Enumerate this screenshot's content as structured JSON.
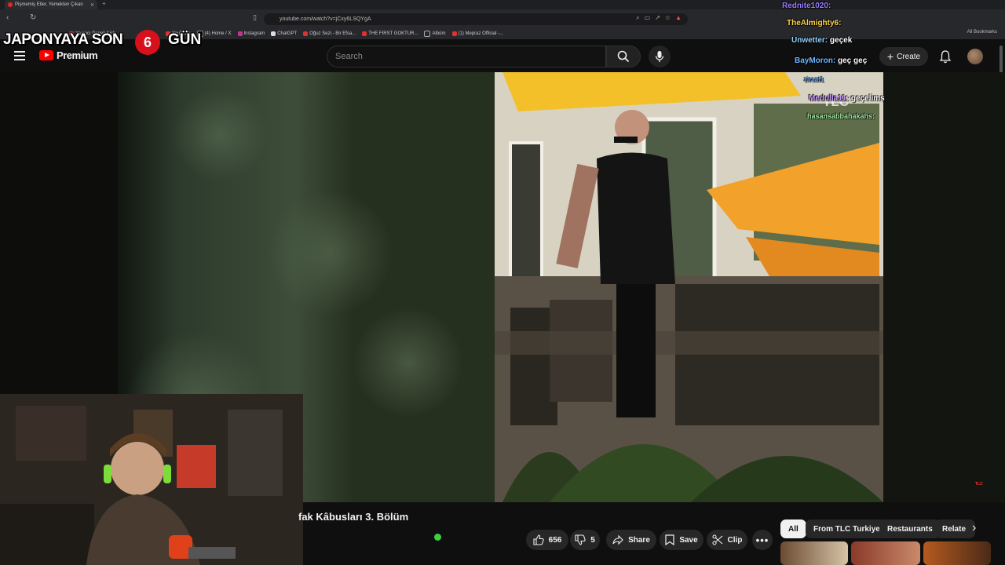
{
  "browser": {
    "tab_title": "Pişmemiş Etler, Yemekten Çıkan",
    "url": "youtube.com/watch?v=jCxy6LSQYgA",
    "bookmarks": [
      "Yayıncı Paneli Kick",
      "YouTube",
      "(4) Home / X",
      "Instagram",
      "ChatGPT",
      "Oğuz Sezi - Bir Efsa...",
      "THE FIRST GOKTUR...",
      "Albüm",
      "(1) Mepraz Official -..."
    ],
    "all_bookmarks": "All Bookmarks"
  },
  "overlay": {
    "countdown_prefix": "JAPONYAYA SON",
    "countdown_day": "6",
    "countdown_suffix": "GÜN"
  },
  "youtube": {
    "logo_text": "Premium",
    "search_placeholder": "Search",
    "create_label": "Create"
  },
  "chat": [
    {
      "user": "Rednite1020:",
      "message": "",
      "color": "#9b7bff"
    },
    {
      "user": "TheAlmighty6:",
      "message": "",
      "color": "#ffd54a"
    },
    {
      "user": "Unwetter:",
      "message": "geçek",
      "color": "#8fd3ff"
    },
    {
      "user": "BayMoron:",
      "message": "geç geç",
      "color": "#6fb8ff"
    },
    {
      "user": "ziraat1",
      "message": "",
      "color": "#4aa3ff"
    },
    {
      "user": "Medulla11:",
      "message": "geçelims",
      "color": "#c79bff"
    },
    {
      "user": "hasansabbahakahs:",
      "message": "",
      "color": "#9ee6a0"
    }
  ],
  "video": {
    "channel_watermark": "TLC",
    "title": "fak Kâbusları 3. Bölüm",
    "likes": "656",
    "dislikes": "5",
    "share_label": "Share",
    "save_label": "Save",
    "clip_label": "Clip"
  },
  "chips": [
    "All",
    "From TLC Turkiye",
    "Restaurants",
    "Relate"
  ]
}
